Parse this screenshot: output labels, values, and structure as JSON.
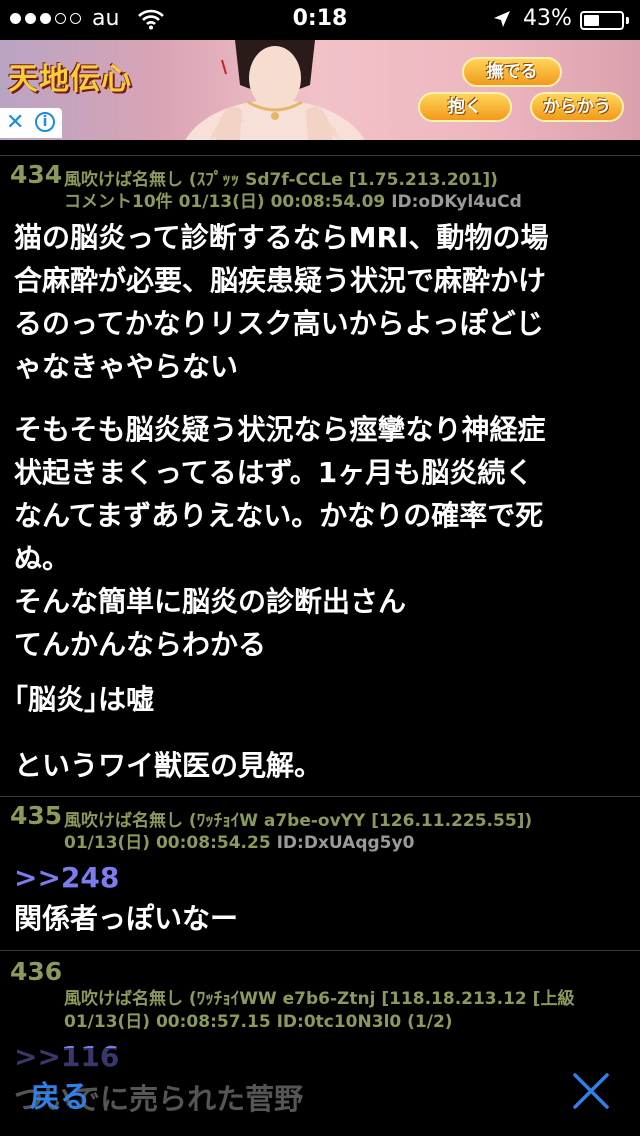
{
  "status_bar": {
    "carrier": "au",
    "time": "0:18",
    "battery_percent": "43%",
    "battery_level": 0.43,
    "signal_bars_filled": 3,
    "signal_bars_total": 5
  },
  "ad": {
    "logo_text": "天地伝心",
    "buttons": [
      "撫でる",
      "抱く",
      "からかう"
    ],
    "close_glyph": "✕",
    "info_glyph": "i"
  },
  "posts": [
    {
      "number": "434",
      "name_line": "風吹けば名無し (ｽﾌﾟｯｯ Sd7f-CCLe [1.75.213.201])",
      "comment_count": "コメント10件",
      "datetime": "01/13(日) 00:08:54.09",
      "id": "ID:oDKyl4uCd",
      "paragraphs": [
        "猫の脳炎って診断するならMRI、動物の場\n合麻酔が必要、脳疾患疑う状況で麻酔かけ\nるのってかなりリスク高いからよっぽどじ\nゃなきゃやらない",
        "そもそも脳炎疑う状況なら痙攣なり神経症\n状起きまくってるはず。1ヶ月も脳炎続く\nなんてまずありえない。かなりの確率で死\nぬ。\nそんな簡単に脳炎の診断出さん\nてんかんならわかる",
        "｢脳炎｣は嘘",
        "というワイ獣医の見解。"
      ]
    },
    {
      "number": "435",
      "name_line": "風吹けば名無し (ﾜｯﾁｮｲW a7be-ovYY [126.11.225.55])",
      "datetime": "01/13(日) 00:08:54.25",
      "id": "ID:DxUAqg5y0",
      "anchor": ">>248",
      "text": "関係者っぽいなー"
    },
    {
      "number": "436",
      "name_line": "風吹けば名無し (ﾜｯﾁｮｲWW e7b6-Ztnj [118.18.213.12 [上級",
      "datetime_id": "01/13(日) 00:08:57.15 ID:0tc10N3l0 (1/2)",
      "anchor": ">>116"
    }
  ],
  "bottom_bar": {
    "ghost_text": "ついでに売られた菅野",
    "back_label": "戻る"
  },
  "colors": {
    "background": "#000000",
    "meta_green": "#8a9a5a",
    "anchor_blue": "#7c7cf0",
    "action_blue": "#2f80e8"
  }
}
